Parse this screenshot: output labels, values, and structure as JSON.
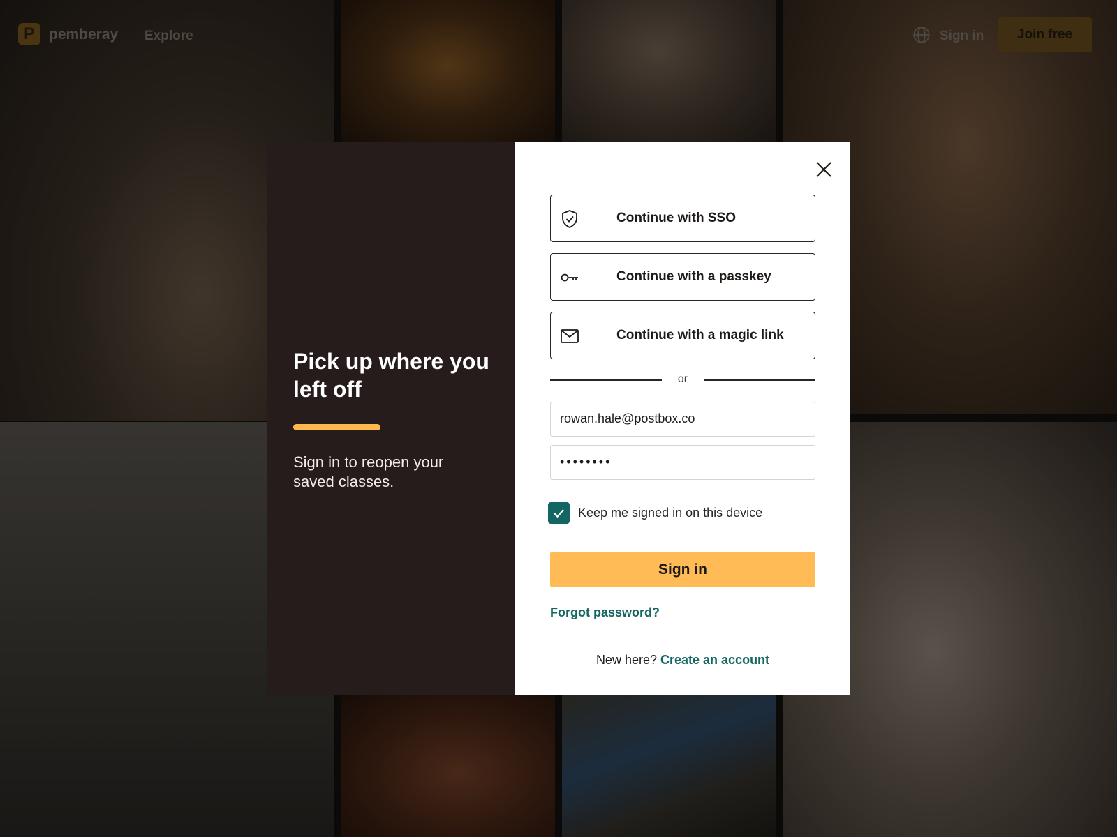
{
  "topbar": {
    "logo_letter": "P",
    "brand": "pemberay",
    "nav_explore": "Explore",
    "nav_signin": "Sign in",
    "join_button": "Join free"
  },
  "modal": {
    "left": {
      "headline": "Pick up where you left off",
      "subtext": "Sign in to reopen your saved classes."
    },
    "auth_options": [
      {
        "label": "Continue with SSO",
        "icon": "shield-check-icon"
      },
      {
        "label": "Continue with a passkey",
        "icon": "key-icon"
      },
      {
        "label": "Continue with a magic link",
        "icon": "envelope-icon"
      }
    ],
    "divider_text": "or",
    "email_value": "rowan.hale@postbox.co",
    "password_value": "••••••••",
    "keep_signed_in": {
      "label": "Keep me signed in on this device",
      "checked": true
    },
    "signin_button": "Sign in",
    "forgot_password": "Forgot password?",
    "new_here": "New here?",
    "create_account": "Create an account"
  },
  "colors": {
    "accent": "#ffbb56",
    "teal": "#146663",
    "panel_dark": "#261c1b"
  }
}
